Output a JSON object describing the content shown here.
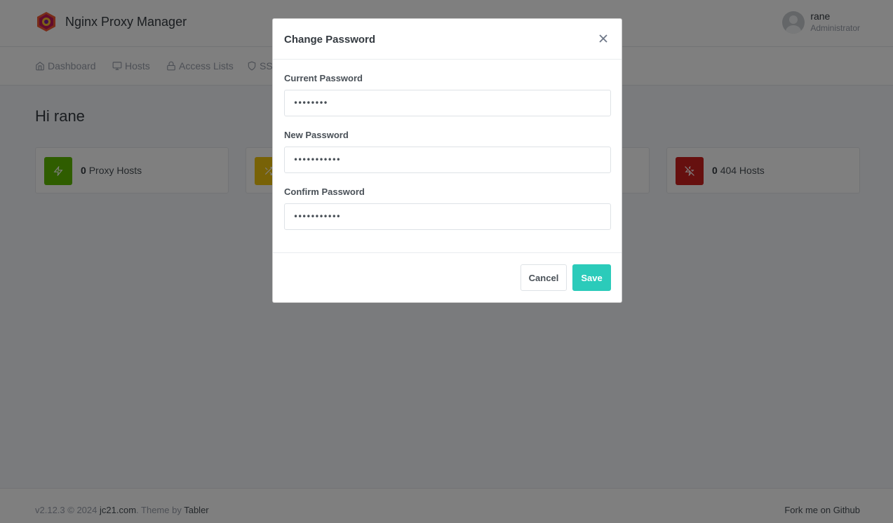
{
  "brand": {
    "name": "Nginx Proxy Manager"
  },
  "user": {
    "name": "rane",
    "role": "Administrator"
  },
  "nav": {
    "items": [
      {
        "label": "Dashboard",
        "icon": "home-icon"
      },
      {
        "label": "Hosts",
        "icon": "monitor-icon"
      },
      {
        "label": "Access Lists",
        "icon": "lock-icon"
      },
      {
        "label": "SSL",
        "icon": "shield-icon"
      }
    ]
  },
  "dashboard": {
    "greeting": "Hi rane",
    "cards": [
      {
        "count": "0",
        "label": "Proxy Hosts",
        "icon": "zap-icon",
        "color": "#5eba00"
      },
      {
        "count": "",
        "label": "",
        "icon": "shuffle-icon",
        "color": "#f1c40f"
      },
      {
        "count": "0",
        "label": "404 Hosts",
        "icon": "zap-off-icon",
        "color": "#cd201f"
      }
    ]
  },
  "modal": {
    "title": "Change Password",
    "close_icon": "close-icon",
    "fields": {
      "current": {
        "label": "Current Password",
        "value": "••••••••"
      },
      "new": {
        "label": "New Password",
        "value": "•••••••••••"
      },
      "confirm": {
        "label": "Confirm Password",
        "value": "•••••••••••"
      }
    },
    "cancel_label": "Cancel",
    "save_label": "Save",
    "save_color": "#2bcbba"
  },
  "footer": {
    "version": "v2.12.3 © 2024",
    "author_link": "jc21.com",
    "theme_prefix": ". Theme by",
    "theme_link": "Tabler",
    "github_link": "Fork me on Github"
  }
}
